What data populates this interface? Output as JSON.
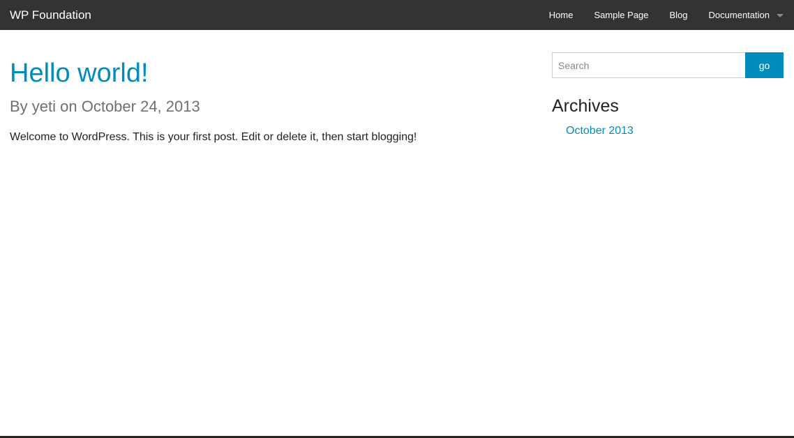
{
  "header": {
    "brand": "WP Foundation",
    "nav": [
      {
        "label": "Home"
      },
      {
        "label": "Sample Page"
      },
      {
        "label": "Blog"
      },
      {
        "label": "Documentation",
        "has_dropdown": true
      }
    ]
  },
  "post": {
    "title": "Hello world!",
    "meta": "By yeti on October 24, 2013",
    "body": "Welcome to WordPress. This is your first post. Edit or delete it, then start blogging!"
  },
  "sidebar": {
    "search": {
      "placeholder": "Search",
      "value": "",
      "button_label": "go"
    },
    "archives": {
      "title": "Archives",
      "items": [
        {
          "label": "October 2013"
        }
      ]
    }
  },
  "icons": {
    "dropdown": "chevron-down-icon"
  },
  "colors": {
    "topbar": "#333333",
    "accent": "#008cba",
    "meta_text": "#6f6f6f"
  }
}
